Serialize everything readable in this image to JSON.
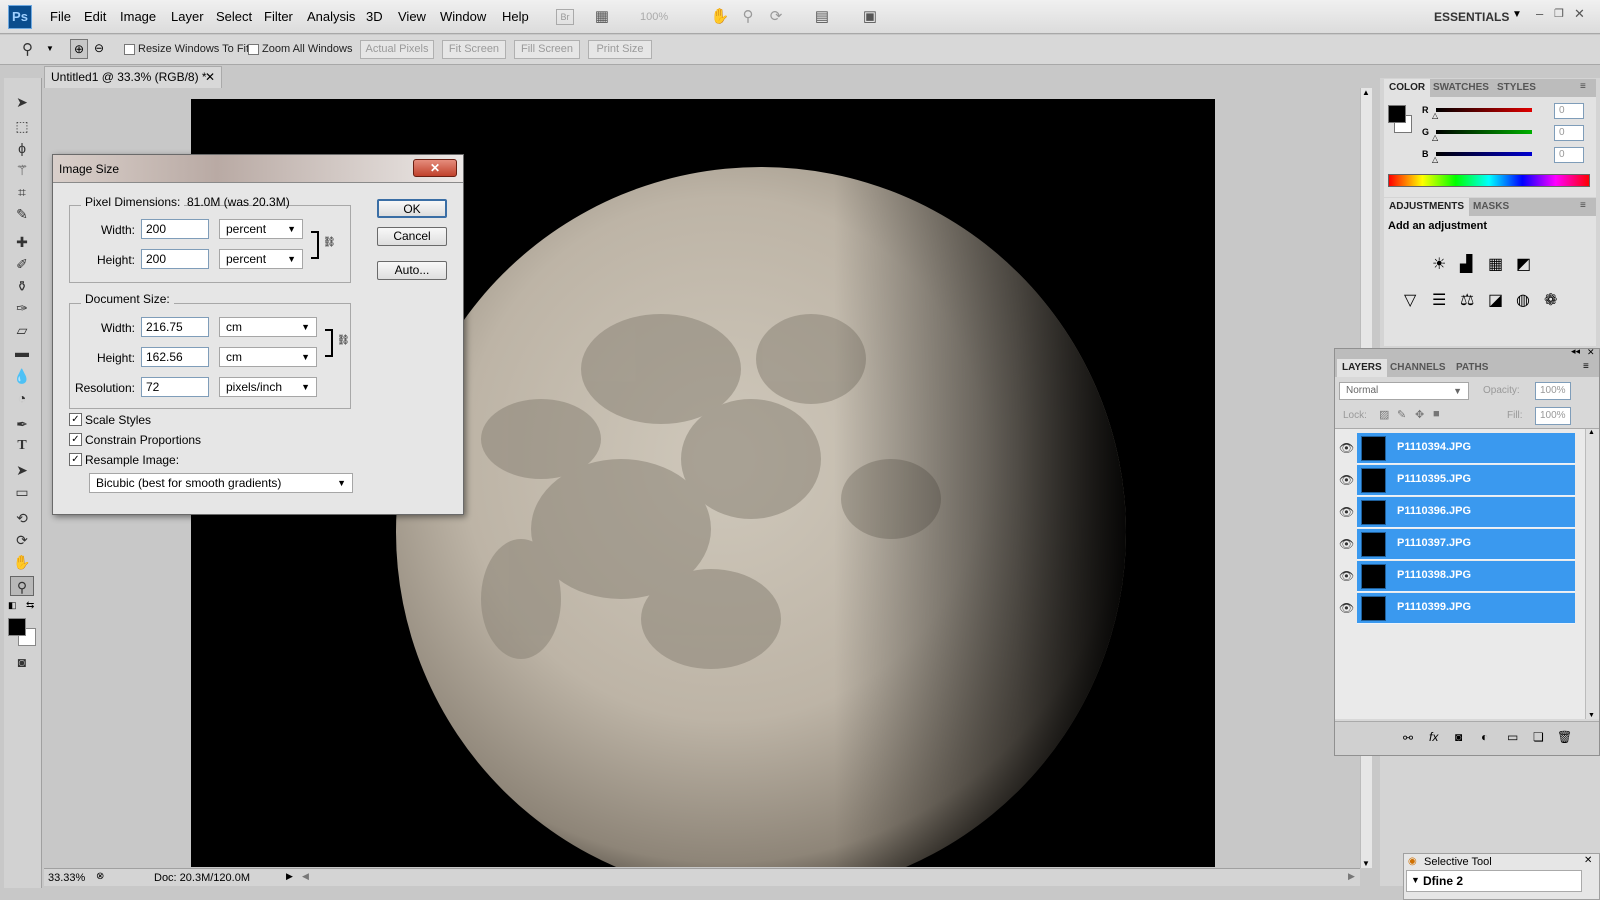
{
  "app": {
    "logo": "Ps",
    "workspace": "ESSENTIALS",
    "zoom_field": "100%"
  },
  "menu": [
    "File",
    "Edit",
    "Image",
    "Layer",
    "Select",
    "Filter",
    "Analysis",
    "3D",
    "View",
    "Window",
    "Help"
  ],
  "menu_extra": {
    "br": "Br"
  },
  "options": {
    "resize_windows": "Resize Windows To Fit",
    "zoom_all": "Zoom All Windows",
    "actual_pixels": "Actual Pixels",
    "fit_screen": "Fit Screen",
    "fill_screen": "Fill Screen",
    "print_size": "Print Size"
  },
  "document": {
    "tab_title": "Untitled1 @ 33.3% (RGB/8) *",
    "zoom": "33.33%",
    "doc_info": "Doc: 20.3M/120.0M"
  },
  "panels": {
    "color_tabs": [
      "COLOR",
      "SWATCHES",
      "STYLES"
    ],
    "channels": [
      {
        "label": "R",
        "value": "0",
        "color": "#e00000"
      },
      {
        "label": "G",
        "value": "0",
        "color": "#00b000"
      },
      {
        "label": "B",
        "value": "0",
        "color": "#0000d0"
      }
    ],
    "adj_tabs": [
      "ADJUSTMENTS",
      "MASKS"
    ],
    "adj_hint": "Add an adjustment",
    "layers_tabs": [
      "LAYERS",
      "CHANNELS",
      "PATHS"
    ],
    "blend_mode": "Normal",
    "opacity_label": "Opacity:",
    "opacity": "100%",
    "lock_label": "Lock:",
    "fill_label": "Fill:",
    "fill": "100%",
    "layers": [
      "P1110394.JPG",
      "P1110395.JPG",
      "P1110396.JPG",
      "P1110397.JPG",
      "P1110398.JPG",
      "P1110399.JPG"
    ],
    "selective_title": "Selective Tool",
    "selective_item": "Dfine 2"
  },
  "dialog": {
    "title": "Image Size",
    "pixel_dims_label": "Pixel Dimensions:",
    "pixel_dims_value": "81.0M (was 20.3M)",
    "px_width_label": "Width:",
    "px_width": "200",
    "px_width_unit": "percent",
    "px_height_label": "Height:",
    "px_height": "200",
    "px_height_unit": "percent",
    "doc_size_label": "Document Size:",
    "doc_width_label": "Width:",
    "doc_width": "216.75",
    "doc_width_unit": "cm",
    "doc_height_label": "Height:",
    "doc_height": "162.56",
    "doc_height_unit": "cm",
    "resolution_label": "Resolution:",
    "resolution": "72",
    "resolution_unit": "pixels/inch",
    "scale_styles": "Scale Styles",
    "constrain": "Constrain Proportions",
    "resample": "Resample Image:",
    "resample_method": "Bicubic (best for smooth gradients)",
    "ok": "OK",
    "cancel": "Cancel",
    "auto": "Auto..."
  }
}
